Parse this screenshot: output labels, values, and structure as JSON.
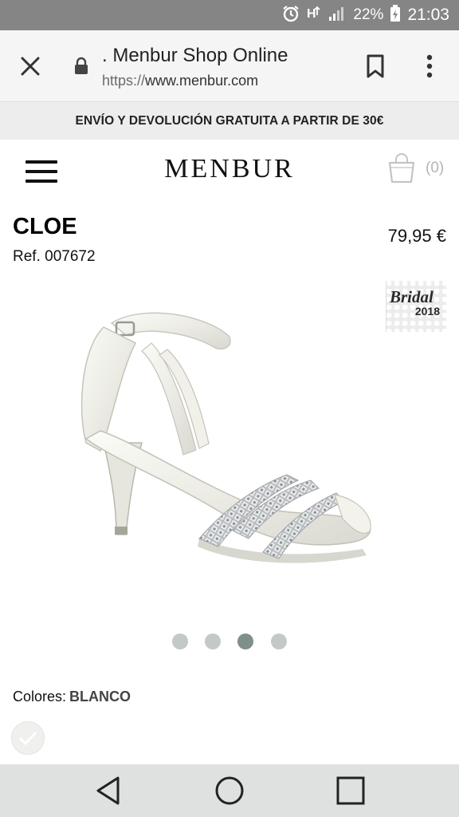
{
  "status_bar": {
    "battery_percent": "22%",
    "time": "21:03",
    "icons": [
      "alarm-icon",
      "data-signal-icon",
      "cell-signal-icon",
      "battery-charging-icon"
    ]
  },
  "browser": {
    "page_title": ". Menbur Shop Online",
    "url_scheme": "https://",
    "url_host": "www.menbur.com",
    "icons": [
      "close-icon",
      "lock-icon",
      "bookmark-icon",
      "more-vert-icon"
    ]
  },
  "promo_banner": "ENVÍO Y DEVOLUCIÓN GRATUITA A PARTIR DE 30€",
  "header": {
    "logo": "MENBUR",
    "cart_count": "(0)",
    "icons": [
      "hamburger-icon",
      "shopping-bag-icon"
    ]
  },
  "product": {
    "name": "CLOE",
    "ref": "Ref. 007672",
    "price": "79,95 €",
    "badge_line1": "Bridal",
    "badge_line2": "2018",
    "image_dots_total": 4,
    "image_dots_active_index": 2,
    "colors_label": "Colores:",
    "colors_value": "BLANCO"
  },
  "nav_bar": {
    "icons": [
      "back-triangle-icon",
      "home-circle-icon",
      "recents-square-icon"
    ]
  },
  "colors": {
    "status_bar": "#858585",
    "toolbar": "#f5f5f5",
    "promo_bg": "#ededed",
    "active_dot": "#7f8f8b",
    "inactive_dot": "#c3c9c8",
    "nav_bar": "#dfe1e1"
  }
}
